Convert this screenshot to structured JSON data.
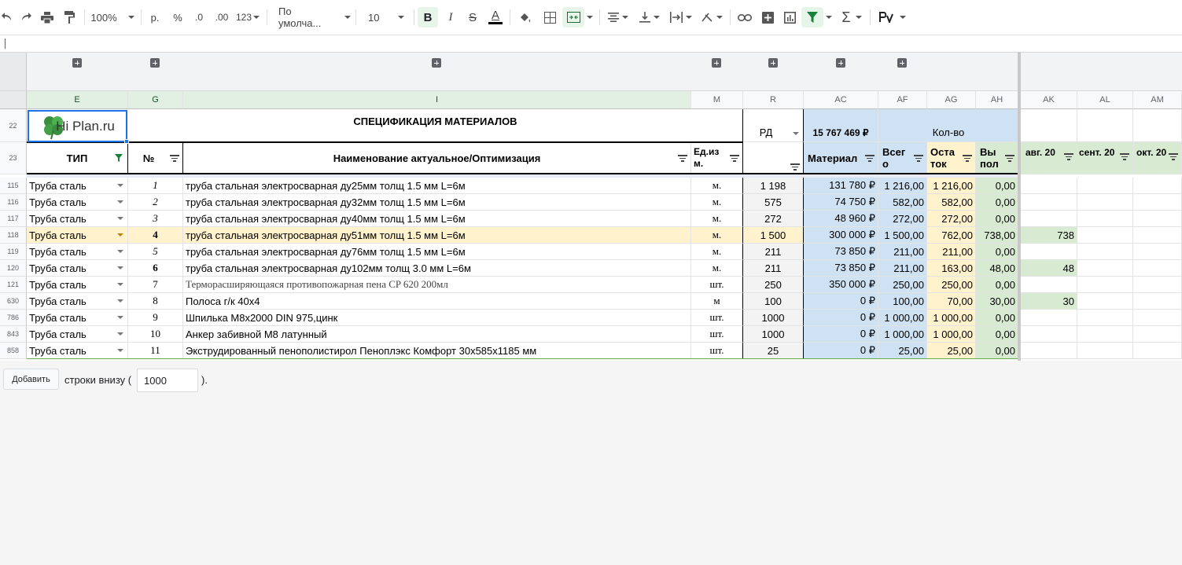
{
  "toolbar": {
    "zoom": "100%",
    "currency": "р.",
    "percent": "%",
    "dec_less": ".0",
    "dec_more": ".00",
    "number_format": "123",
    "font": "По умолча...",
    "font_size": "10",
    "bold": "B",
    "italic": "I",
    "strikethrough": "S",
    "text_color": "A",
    "sum": "Σ"
  },
  "columns": [
    "E",
    "G",
    "I",
    "M",
    "R",
    "AC",
    "AF",
    "AG",
    "AH",
    "AK",
    "AL",
    "AM"
  ],
  "header1": {
    "row_number": "22",
    "logo_text": "Hi Plan.ru",
    "title": "СПЕЦИФИКАЦИЯ МАТЕРИАЛОВ",
    "rd": "РД",
    "total": "15 767 469 ₽",
    "qty": "Кол-во"
  },
  "header2": {
    "row_number": "23",
    "type": "ТИП",
    "num": "№",
    "name": "Наименование актуальное/Оптимизация",
    "unit": "Ед.из м.",
    "material": "Материал",
    "total_label": "Всег о",
    "rest_label": "Оста ток",
    "done_label": "Вы пол",
    "aug": "авг. 20",
    "sep": "сент. 20",
    "oct": "окт. 20"
  },
  "rows": [
    {
      "n": "115",
      "type": "Труба сталь",
      "num": "1",
      "name": "труба стальная электросварная ду25мм толщ 1.5 мм L=6м",
      "unit": "м.",
      "rd": "1 198",
      "mat": "131 780 ₽",
      "total": "1 216,00",
      "rest": "1 216,00",
      "done": "0,00",
      "aug": ""
    },
    {
      "n": "116",
      "type": "Труба сталь",
      "num": "2",
      "name": "труба стальная электросварная ду32мм толщ 1.5 мм L=6м",
      "unit": "м.",
      "rd": "575",
      "mat": "74 750 ₽",
      "total": "582,00",
      "rest": "582,00",
      "done": "0,00",
      "aug": ""
    },
    {
      "n": "117",
      "type": "Труба сталь",
      "num": "3",
      "name": "труба стальная электросварная ду40мм толщ 1.5 мм L=6м",
      "unit": "м.",
      "rd": "272",
      "mat": "48 960 ₽",
      "total": "272,00",
      "rest": "272,00",
      "done": "0,00",
      "aug": ""
    },
    {
      "n": "118",
      "type": "Труба сталь",
      "num": "4",
      "name": "труба стальная электросварная ду51мм толщ 1.5 мм L=6м",
      "unit": "м.",
      "rd": "1 500",
      "mat": "300 000 ₽",
      "total": "1 500,00",
      "rest": "762,00",
      "done": "738,00",
      "aug": "738"
    },
    {
      "n": "119",
      "type": "Труба сталь",
      "num": "5",
      "name": "труба стальная электросварная ду76мм толщ 1.5 мм L=6м",
      "unit": "м.",
      "rd": "211",
      "mat": "73 850 ₽",
      "total": "211,00",
      "rest": "211,00",
      "done": "0,00",
      "aug": ""
    },
    {
      "n": "120",
      "type": "Труба сталь",
      "num": "6",
      "name": "труба стальная электросварная ду102мм толщ 3.0 мм L=6м",
      "unit": "м.",
      "rd": "211",
      "mat": "73 850 ₽",
      "total": "211,00",
      "rest": "163,00",
      "done": "48,00",
      "aug": "48"
    },
    {
      "n": "121",
      "type": "Труба сталь",
      "num": "7",
      "name": "Терморасширяющаяся противопожарная пена CP 620 200мл",
      "unit": "шт.",
      "rd": "250",
      "mat": "350 000 ₽",
      "total": "250,00",
      "rest": "250,00",
      "done": "0,00",
      "aug": ""
    },
    {
      "n": "630",
      "type": "Труба сталь",
      "num": "8",
      "name": "Полоса г/к 40х4",
      "unit": "м",
      "rd": "100",
      "mat": "0 ₽",
      "total": "100,00",
      "rest": "70,00",
      "done": "30,00",
      "aug": "30"
    },
    {
      "n": "786",
      "type": "Труба сталь",
      "num": "9",
      "name": "Шпилька M8x2000 DIN 975,цинк",
      "unit": "шт.",
      "rd": "1000",
      "mat": "0 ₽",
      "total": "1 000,00",
      "rest": "1 000,00",
      "done": "0,00",
      "aug": ""
    },
    {
      "n": "843",
      "type": "Труба сталь",
      "num": "10",
      "name": "Анкер забивной M8 латунный",
      "unit": "шт.",
      "rd": "1000",
      "mat": "0 ₽",
      "total": "1 000,00",
      "rest": "1 000,00",
      "done": "0,00",
      "aug": ""
    },
    {
      "n": "858",
      "type": "Труба сталь",
      "num": "11",
      "name": "Экструдированный пенополистирол Пеноплэкс Комфорт 30x585x1185 мм",
      "unit": "шт.",
      "rd": "25",
      "mat": "0 ₽",
      "total": "25,00",
      "rest": "25,00",
      "done": "0,00",
      "aug": ""
    }
  ],
  "footer": {
    "add_button": "Добавить",
    "text_before": "строки внизу (",
    "count": "1000",
    "text_after": ")."
  },
  "colors": {
    "blue": "#cfe2f3",
    "yellow": "#fff2cc",
    "green": "#d9ead3",
    "selection": "#1a73e8",
    "filter_active": "#188038"
  }
}
